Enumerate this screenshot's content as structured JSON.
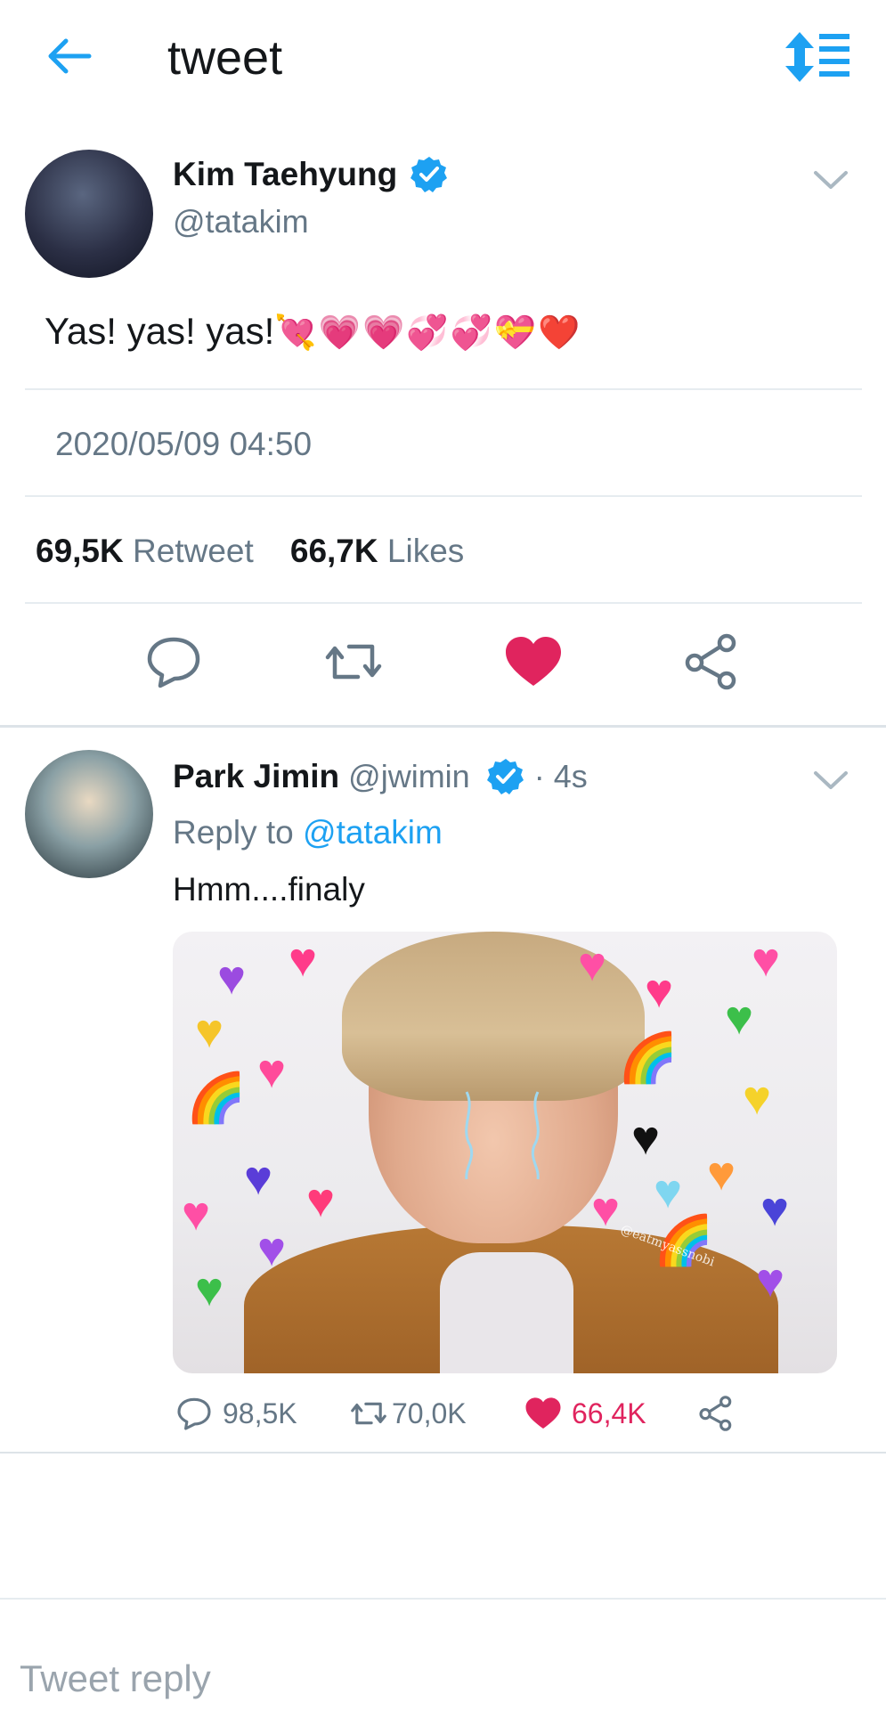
{
  "header": {
    "title": "tweet",
    "back_icon": "arrow-left-icon",
    "sort_icon": "sort-icon"
  },
  "tweet": {
    "author_name": "Kim Taehyung",
    "author_handle": "@tatakim",
    "text": "Yas! yas! yas!",
    "emoji": "💘💗💗💞💞💝❤️",
    "datetime": "2020/05/09 04:50",
    "retweets": "69,5K",
    "retweet_label": "Retweet",
    "likes": "66,7K",
    "likes_label": "Likes"
  },
  "reply": {
    "author_name": "Park Jimin",
    "author_handle": "@jwimin",
    "time": "· 4s",
    "reply_to_label": "Reply to",
    "reply_to_handle": "@tatakim",
    "text": "Hmm....finaly",
    "media_watermark": "@eatmyassnobi",
    "replies": "98,5K",
    "retweets": "70,0K",
    "likes": "66,4K"
  },
  "composer": {
    "placeholder": "Tweet reply"
  },
  "colors": {
    "accent": "#1da1f2",
    "like": "#e0245e",
    "muted": "#657786"
  }
}
